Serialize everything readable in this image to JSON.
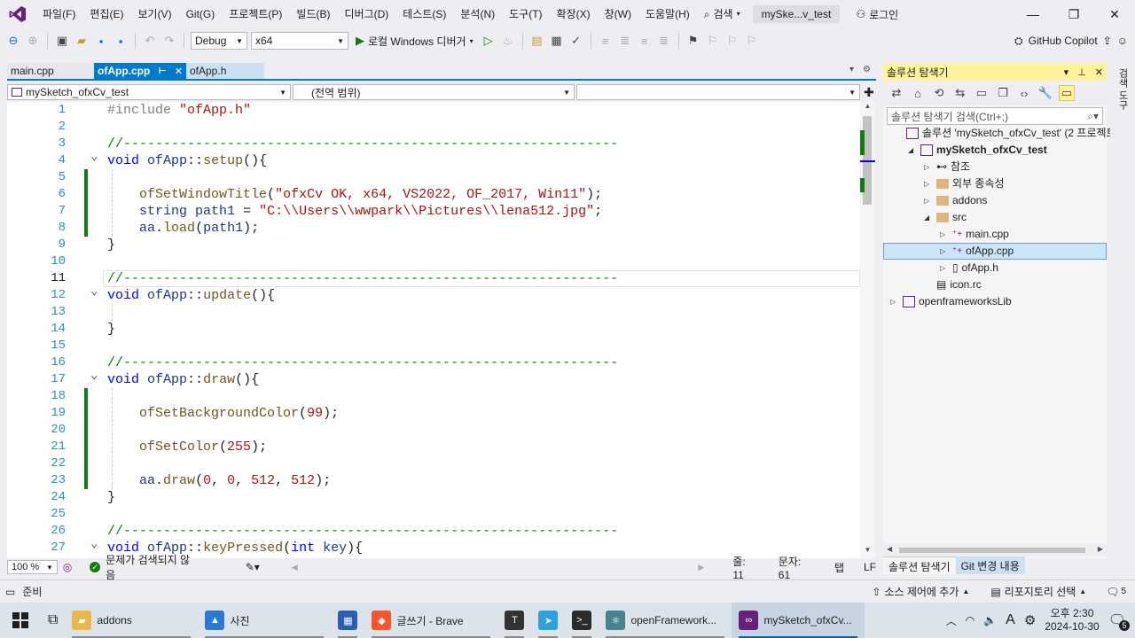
{
  "menu": {
    "items": [
      "파일(F)",
      "편집(E)",
      "보기(V)",
      "Git(G)",
      "프로젝트(P)",
      "빌드(B)",
      "디버그(D)",
      "테스트(S)",
      "분석(N)",
      "도구(T)",
      "확장(X)",
      "창(W)",
      "도움말(H)"
    ],
    "search_label": "검색",
    "solution_title": "mySke...v_test",
    "login_label": "로그인",
    "window_controls": [
      "—",
      "❐",
      "✕"
    ]
  },
  "toolbar": {
    "config": "Debug",
    "platform": "x64",
    "run_label": "로컬 Windows 디버거",
    "copilot_label": "GitHub Copilot"
  },
  "doc_tabs": [
    {
      "label": "main.cpp"
    },
    {
      "label": "ofApp.cpp"
    },
    {
      "label": "ofApp.h"
    }
  ],
  "navbar": {
    "project": "mySketch_ofxCv_test",
    "scope": "(전역 범위)",
    "member": ""
  },
  "code_lines": [
    {
      "n": "1",
      "html": "<span class=\"pp\">#include</span> <span class=\"str\">\"ofApp.h\"</span>"
    },
    {
      "n": "2",
      "html": ""
    },
    {
      "n": "3",
      "html": "<span class=\"cm\">//--------------------------------------------------------------</span>"
    },
    {
      "n": "4",
      "html": "<span class=\"kw\">void</span> <span class=\"id\">ofApp</span>::<span class=\"fn\">setup</span>(){"
    },
    {
      "n": "5",
      "html": ""
    },
    {
      "n": "6",
      "html": "    <span class=\"fn\">ofSetWindowTitle</span>(<span class=\"str\">\"ofxCv OK, x64, VS2022, OF_2017, Win11\"</span>);"
    },
    {
      "n": "7",
      "html": "    <span class=\"id\">string</span> <span class=\"id\">path1</span> = <span class=\"str\">\"C:\\\\Users\\\\wwpark\\\\Pictures\\\\lena512.jpg\"</span>;"
    },
    {
      "n": "8",
      "html": "    <span class=\"id\">aa</span>.<span class=\"fn\">load</span>(<span class=\"id\">path1</span>);"
    },
    {
      "n": "9",
      "html": "}"
    },
    {
      "n": "10",
      "html": ""
    },
    {
      "n": "11",
      "html": "<span class=\"cm\">//--------------------------------------------------------------</span>"
    },
    {
      "n": "12",
      "html": "<span class=\"kw\">void</span> <span class=\"id\">ofApp</span>::<span class=\"fn\">update</span>(){"
    },
    {
      "n": "13",
      "html": ""
    },
    {
      "n": "14",
      "html": "}"
    },
    {
      "n": "15",
      "html": ""
    },
    {
      "n": "16",
      "html": "<span class=\"cm\">//--------------------------------------------------------------</span>"
    },
    {
      "n": "17",
      "html": "<span class=\"kw\">void</span> <span class=\"id\">ofApp</span>::<span class=\"fn\">draw</span>(){"
    },
    {
      "n": "18",
      "html": ""
    },
    {
      "n": "19",
      "html": "    <span class=\"fn\">ofSetBackgroundColor</span>(<span class=\"num\">99</span>);"
    },
    {
      "n": "20",
      "html": ""
    },
    {
      "n": "21",
      "html": "    <span class=\"fn\">ofSetColor</span>(<span class=\"num\">255</span>);"
    },
    {
      "n": "22",
      "html": ""
    },
    {
      "n": "23",
      "html": "    <span class=\"id\">aa</span>.<span class=\"fn\">draw</span>(<span class=\"num\">0</span>, <span class=\"num\">0</span>, <span class=\"num\">512</span>, <span class=\"num\">512</span>);"
    },
    {
      "n": "24",
      "html": "}"
    },
    {
      "n": "25",
      "html": ""
    },
    {
      "n": "26",
      "html": "<span class=\"cm\">//--------------------------------------------------------------</span>"
    },
    {
      "n": "27",
      "html": "<span class=\"kw\">void</span> <span class=\"id\">ofApp</span>::<span class=\"fn\">keyPressed</span>(<span class=\"kw\">int</span> <span class=\"id\">key</span>){"
    }
  ],
  "editor_status": {
    "zoom": "100 %",
    "issues": "문제가 검색되지 않음",
    "line": "줄: 11",
    "col": "문자: 61",
    "tab": "탭",
    "eol": "LF"
  },
  "solution_explorer": {
    "title": "솔루션 탐색기",
    "search_placeholder": "솔루션 탐색기 검색(Ctrl+;)",
    "tree": [
      {
        "label": "솔루션 'mySketch_ofxCv_test' (2 프로젝트",
        "depth": 0,
        "exp": ""
      },
      {
        "label": "mySketch_ofxCv_test",
        "depth": 1,
        "exp": "◢",
        "bold": true
      },
      {
        "label": "참조",
        "depth": 2,
        "exp": "▷"
      },
      {
        "label": "외부 종속성",
        "depth": 2,
        "exp": "▷"
      },
      {
        "label": "addons",
        "depth": 2,
        "exp": "▷"
      },
      {
        "label": "src",
        "depth": 2,
        "exp": "◢"
      },
      {
        "label": "main.cpp",
        "depth": 3,
        "exp": "▷"
      },
      {
        "label": "ofApp.cpp",
        "depth": 3,
        "exp": "▷",
        "selected": true
      },
      {
        "label": "ofApp.h",
        "depth": 3,
        "exp": "▷"
      },
      {
        "label": "icon.rc",
        "depth": 2,
        "exp": ""
      },
      {
        "label": "openframeworksLib",
        "depth": 0,
        "exp": "▷"
      }
    ],
    "bottom_tabs": [
      "솔루션 탐색기",
      "Git 변경 내용"
    ]
  },
  "right_rail_label": "검색 도구",
  "statusbar": {
    "ready": "준비",
    "source_control": "소스 제어에 추가",
    "repo": "리포지토리 선택",
    "notif_count": "5"
  },
  "taskbar": {
    "items": [
      {
        "label": "addons",
        "kind": "folder"
      },
      {
        "label": "사진",
        "kind": "photos"
      },
      {
        "label": "",
        "kind": "store"
      },
      {
        "label": "글쓰기 - Brave",
        "kind": "brave"
      },
      {
        "label": "",
        "kind": "typora"
      },
      {
        "label": "",
        "kind": "telegram"
      },
      {
        "label": "",
        "kind": "terminal"
      },
      {
        "label": "openFramework...",
        "kind": "electron"
      },
      {
        "label": "mySketch_ofxCv...",
        "kind": "vs"
      }
    ],
    "time": "오후 2:30",
    "date": "2024-10-30",
    "ime": "A",
    "badge": "5"
  },
  "colors": {
    "accent": "#007acc",
    "vs_purple": "#68217a",
    "change_bar": "#107c10",
    "selection_header": "#fff29d"
  }
}
